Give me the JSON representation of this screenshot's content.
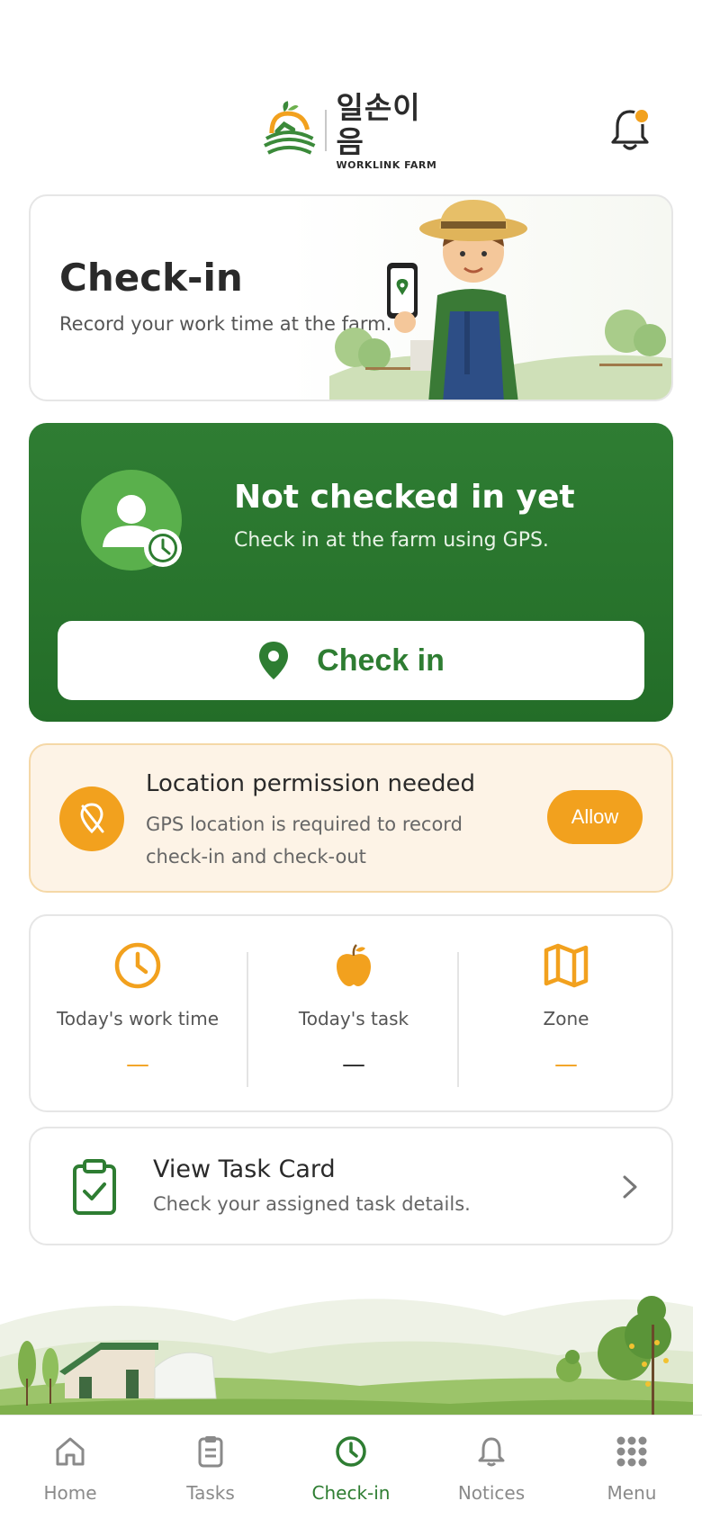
{
  "header": {
    "logo_korean": "일손이음",
    "logo_english": "WORKLINK FARM",
    "notification_dot_color": "#f2a11e"
  },
  "hero": {
    "title": "Check-in",
    "subtitle": "Record your work time at the farm."
  },
  "status": {
    "title": "Not checked in yet",
    "subtitle": "Check in at the farm using GPS.",
    "button_label": "Check in"
  },
  "permission": {
    "title": "Location permission needed",
    "description": "GPS location is required to record check-in and check-out",
    "button_label": "Allow"
  },
  "stats": [
    {
      "label": "Today's work time",
      "value": "—",
      "icon": "clock-icon",
      "value_color": "#f2a11e"
    },
    {
      "label": "Today's task",
      "value": "—",
      "icon": "apple-icon",
      "value_color": "#2a2a2a"
    },
    {
      "label": "Zone",
      "value": "—",
      "icon": "map-icon",
      "value_color": "#f2a11e"
    }
  ],
  "task_card": {
    "title": "View Task Card",
    "subtitle": "Check your assigned task details."
  },
  "nav": [
    {
      "label": "Home",
      "icon": "home-icon",
      "active": false
    },
    {
      "label": "Tasks",
      "icon": "clipboard-icon",
      "active": false
    },
    {
      "label": "Check-in",
      "icon": "clock-icon",
      "active": true
    },
    {
      "label": "Notices",
      "icon": "bell-icon",
      "active": false
    },
    {
      "label": "Menu",
      "icon": "grid-icon",
      "active": false
    }
  ],
  "colors": {
    "primary_green": "#2e7d32",
    "accent_orange": "#f2a11e"
  }
}
